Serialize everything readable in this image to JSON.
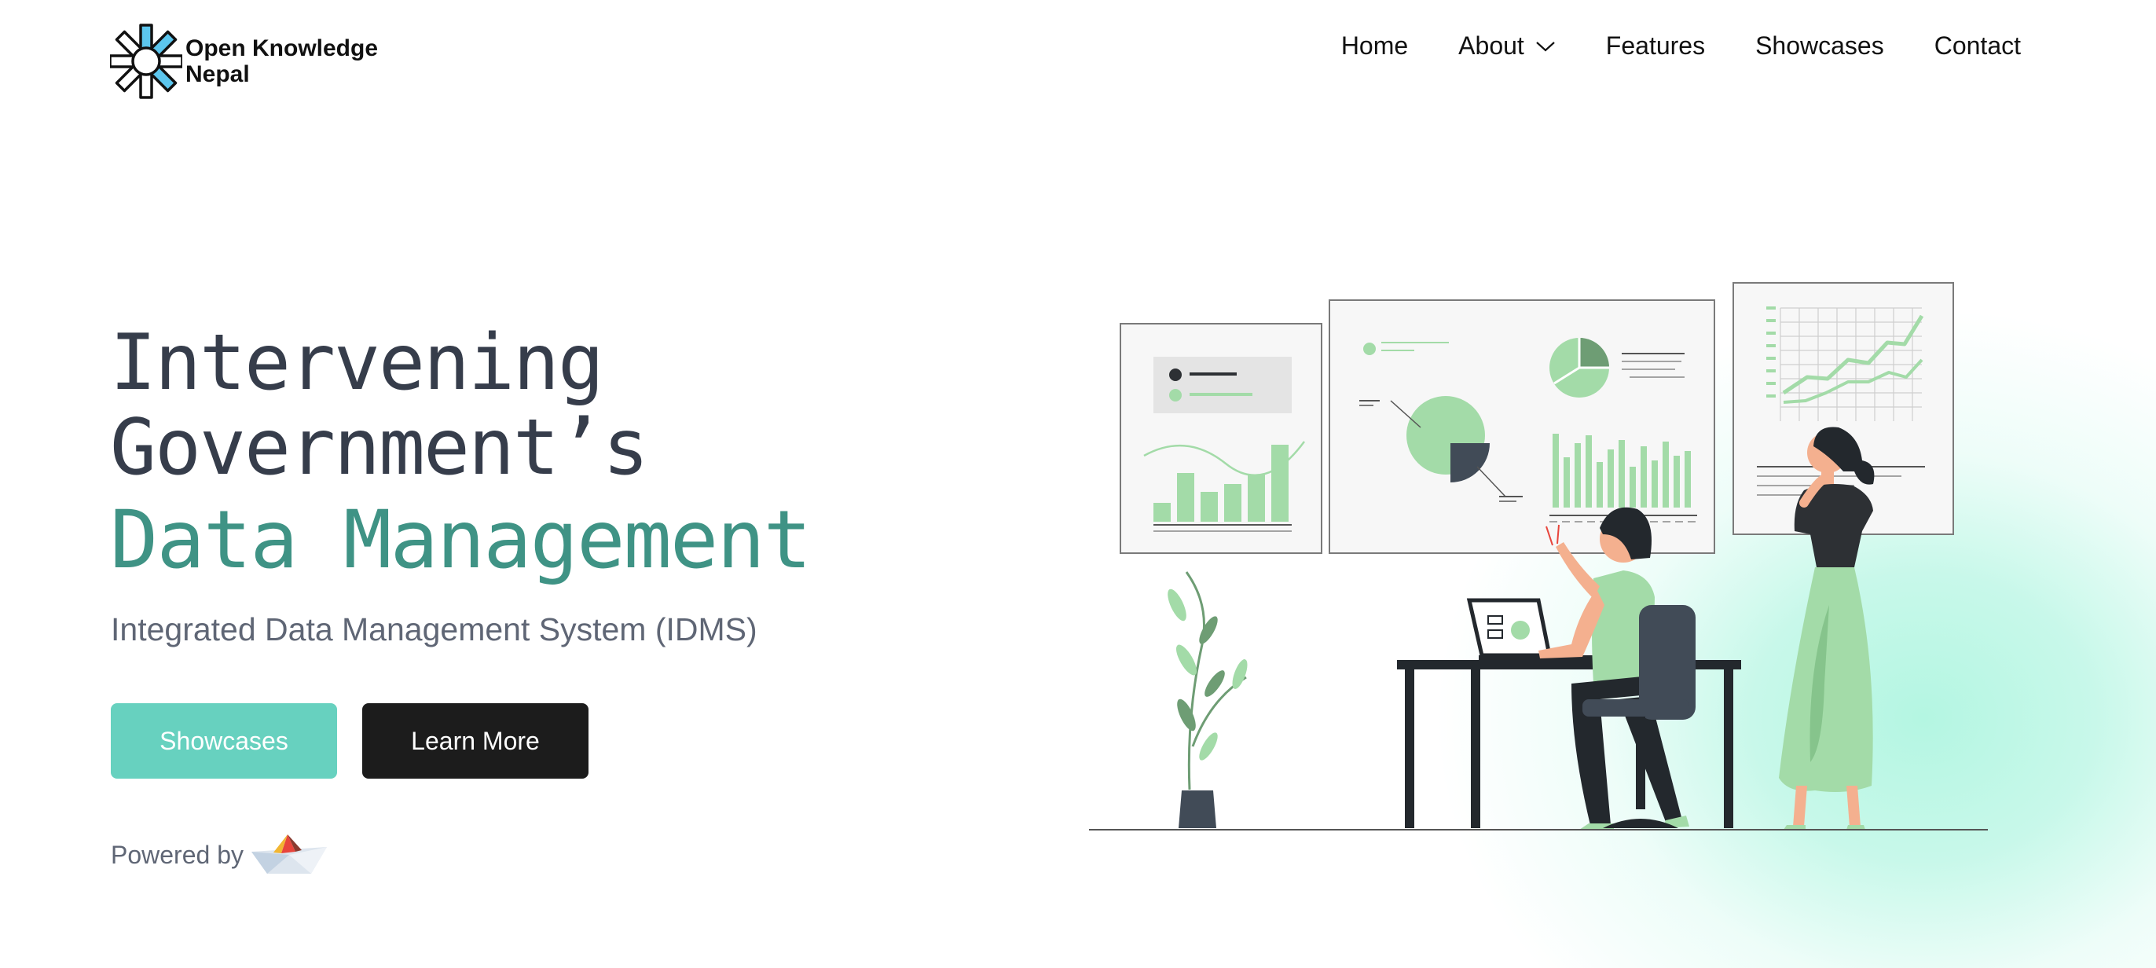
{
  "brand": {
    "name_line1": "Open Knowledge",
    "name_line2": "Nepal",
    "logo_icon": "okn-star-logo"
  },
  "nav": {
    "items": [
      {
        "label": "Home"
      },
      {
        "label": "About",
        "has_dropdown": true
      },
      {
        "label": "Features"
      },
      {
        "label": "Showcases"
      },
      {
        "label": "Contact"
      }
    ]
  },
  "hero": {
    "title_line1": "Intervening",
    "title_line2": "Government’s",
    "title_accent": "Data Management",
    "subtitle": "Integrated Data Management System (IDMS)",
    "primary_button": "Showcases",
    "secondary_button": "Learn More",
    "powered_by_label": "Powered by",
    "powered_by_icon": "paper-boat-logo"
  },
  "colors": {
    "accent_teal": "#3f9385",
    "button_teal": "#67d1bf",
    "button_dark": "#1c1c1c",
    "heading": "#363d4b",
    "mint_glow": "#b4f6e2",
    "illustration_green": "#a3dba8"
  }
}
